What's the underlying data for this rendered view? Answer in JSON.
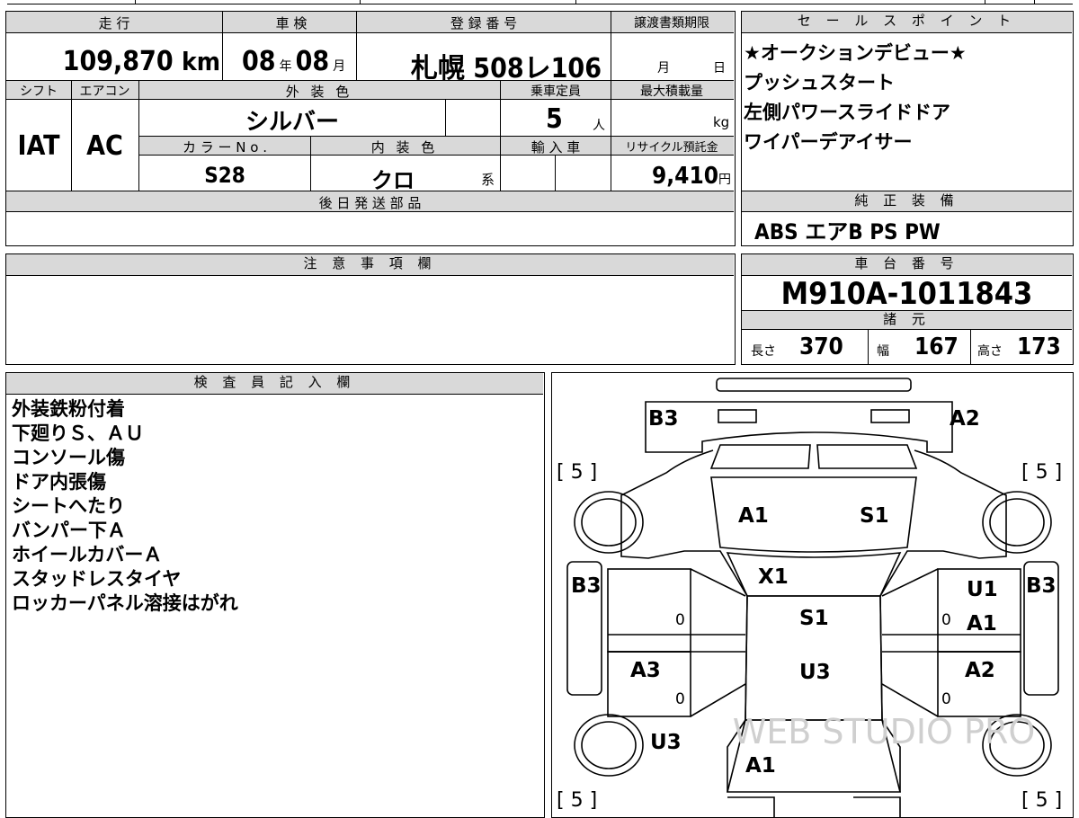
{
  "vehicle": {
    "mileage_label": "走 行",
    "mileage_value": "109,870",
    "mileage_unit": "km",
    "shaken_label": "車 検",
    "shaken_year": "08",
    "year_unit": "年",
    "shaken_month": "08",
    "month_unit": "月",
    "reg_label": "登 録 番 号",
    "reg_value": "札幌 508レ106",
    "transfer_label": "譲渡書類期限",
    "transfer_month": "月",
    "transfer_day": "日",
    "shift_label": "シフト",
    "shift_value": "IAT",
    "ac_label": "エアコン",
    "ac_value": "AC",
    "ext_color_label": "外 装 色",
    "ext_color_value": "シルバー",
    "seats_label": "乗車定員",
    "seats_value": "5",
    "seats_unit": "人",
    "max_load_label": "最大積載量",
    "max_load_unit": "kg",
    "color_no_label": "カ ラ ー N o .",
    "color_no_value": "S28",
    "int_color_label": "内 装 色",
    "int_color_value": "クロ",
    "int_color_suffix": "系",
    "import_label": "輸 入 車",
    "recycle_label": "リサイクル預託金",
    "recycle_value": "9,410",
    "recycle_unit": "円",
    "later_parts_label": "後 日 発 送 部 品"
  },
  "sales_points": {
    "label": "セ ー ル ス ポ イ ン ト",
    "items": [
      "★オークションデビュー★",
      "プッシュスタート",
      "左側パワースライドドア",
      "ワイパーデアイサー"
    ]
  },
  "equipment": {
    "label": "純 正 装 備",
    "value": "ABS エアB PS PW"
  },
  "notes": {
    "label": "注 意 事 項 欄"
  },
  "chassis": {
    "label": "車 台 番 号",
    "value": "M910A-1011843",
    "specs_label": "諸 元",
    "length_label": "長さ",
    "length_value": "370",
    "width_label": "幅",
    "width_value": "167",
    "height_label": "高さ",
    "height_value": "173"
  },
  "inspector": {
    "label": "検 査 員 記 入 欄",
    "lines": [
      "外装鉄粉付着",
      "下廻りＳ、ＡＵ",
      "コンソール傷",
      "ドア内張傷",
      "シートへたり",
      "バンパー下Ａ",
      "ホイールカバーＡ",
      "スタッドレスタイヤ",
      "ロッカーパネル溶接はがれ"
    ]
  },
  "diagram": {
    "marks": {
      "front_left": "B3",
      "front_right": "A2",
      "hood_left": "A1",
      "hood_right": "S1",
      "windshield": "X1",
      "roof_1": "S1",
      "roof_2": "U3",
      "left_front_fender": "B3",
      "right_door_top_1": "U1",
      "right_door_top_2": "A1",
      "right_fender": "B3",
      "left_rear_door": "A3",
      "right_rear_door": "A2",
      "left_quarter": "U3",
      "rear": "A1"
    },
    "tire_tl": "[ 5 ]",
    "tire_tr": "[ 5 ]",
    "tire_bl": "[ 5 ]",
    "tire_br": "[ 5 ]",
    "zero": "0",
    "watermark": "WEB STUDIO PRO"
  }
}
